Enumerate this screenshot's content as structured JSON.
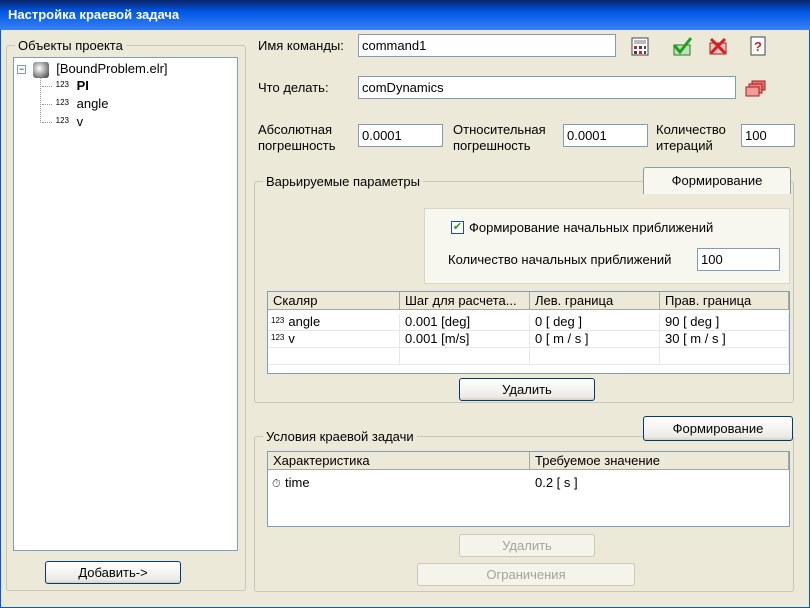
{
  "window": {
    "title": "Настройка краевой задача"
  },
  "left": {
    "group_title": "Объекты проекта",
    "tree": {
      "root": "[BoundProblem.elr]",
      "items": [
        {
          "prefix": "123",
          "label": "PI"
        },
        {
          "prefix": "123",
          "label": "angle"
        },
        {
          "prefix": "123",
          "label": "v"
        }
      ]
    },
    "add_button": "Добавить->"
  },
  "command": {
    "name_label": "Имя команды:",
    "name_value": "command1",
    "action_label": "Что делать:",
    "action_value": "comDynamics"
  },
  "params": {
    "abs_label_1": "Абсолютная",
    "abs_label_2": "погрешность",
    "abs_value": "0.0001",
    "rel_label_1": "Относительная",
    "rel_label_2": "погрешность",
    "rel_value": "0.0001",
    "iter_label_1": "Количество",
    "iter_label_2": "итераций",
    "iter_value": "100"
  },
  "varied": {
    "group_title": "Варьируемые параметры",
    "tab_label": "Формирование",
    "checkbox_label": "Формирование начальных приближений",
    "count_label": "Количество начальных приближений",
    "count_value": "100",
    "columns": [
      "Скаляр",
      "Шаг для расчета...",
      "Лев. граница",
      "Прав. граница"
    ],
    "rows": [
      {
        "prefix": "123",
        "name": "angle",
        "step": "0.001 [deg]",
        "left": "0 [ deg ]",
        "right": "90 [ deg ]"
      },
      {
        "prefix": "123",
        "name": "v",
        "step": "0.001 [m/s]",
        "left": "0 [ m / s ]",
        "right": "30 [ m / s ]"
      }
    ],
    "delete_button": "Удалить"
  },
  "conditions": {
    "group_title": "Условия краевой задачи",
    "form_button": "Формирование",
    "columns": [
      "Характеристика",
      "Требуемое значение"
    ],
    "rows": [
      {
        "name": "time",
        "value": "0.2 [ s ]"
      }
    ],
    "delete_button": "Удалить",
    "constraints_button": "Ограничения"
  },
  "colors": {
    "titlebar": "#0058e6",
    "window_bg": "#ece9d8",
    "accent_red": "#d42020",
    "accent_green": "#20a020"
  }
}
